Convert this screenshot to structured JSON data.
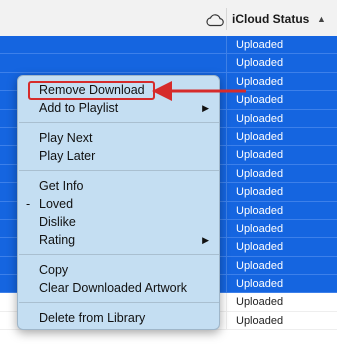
{
  "header": {
    "column_title": "iCloud Status",
    "cloud_icon": "cloud-icon",
    "sort_icon": "chevron-up-icon"
  },
  "rows": [
    {
      "status": "Uploaded",
      "selected": true
    },
    {
      "status": "Uploaded",
      "selected": true
    },
    {
      "status": "Uploaded",
      "selected": true
    },
    {
      "status": "Uploaded",
      "selected": true
    },
    {
      "status": "Uploaded",
      "selected": true
    },
    {
      "status": "Uploaded",
      "selected": true
    },
    {
      "status": "Uploaded",
      "selected": true
    },
    {
      "status": "Uploaded",
      "selected": true
    },
    {
      "status": "Uploaded",
      "selected": true
    },
    {
      "status": "Uploaded",
      "selected": true
    },
    {
      "status": "Uploaded",
      "selected": true
    },
    {
      "status": "Uploaded",
      "selected": true
    },
    {
      "status": "Uploaded",
      "selected": true
    },
    {
      "status": "Uploaded",
      "selected": true
    },
    {
      "status": "Uploaded",
      "selected": false
    },
    {
      "status": "Uploaded",
      "selected": false
    }
  ],
  "menu": {
    "items": {
      "remove_download": "Remove Download",
      "add_to_playlist": "Add to Playlist",
      "play_next": "Play Next",
      "play_later": "Play Later",
      "get_info": "Get Info",
      "loved": "Loved",
      "loved_mark": "-",
      "dislike": "Dislike",
      "rating": "Rating",
      "copy": "Copy",
      "clear_downloaded_artwork": "Clear Downloaded Artwork",
      "delete_from_library": "Delete from Library"
    },
    "submenu_glyph": "▶"
  },
  "colors": {
    "selection": "#1565e0",
    "menu_background": "#c4def2",
    "annotation": "#d62b2b"
  }
}
